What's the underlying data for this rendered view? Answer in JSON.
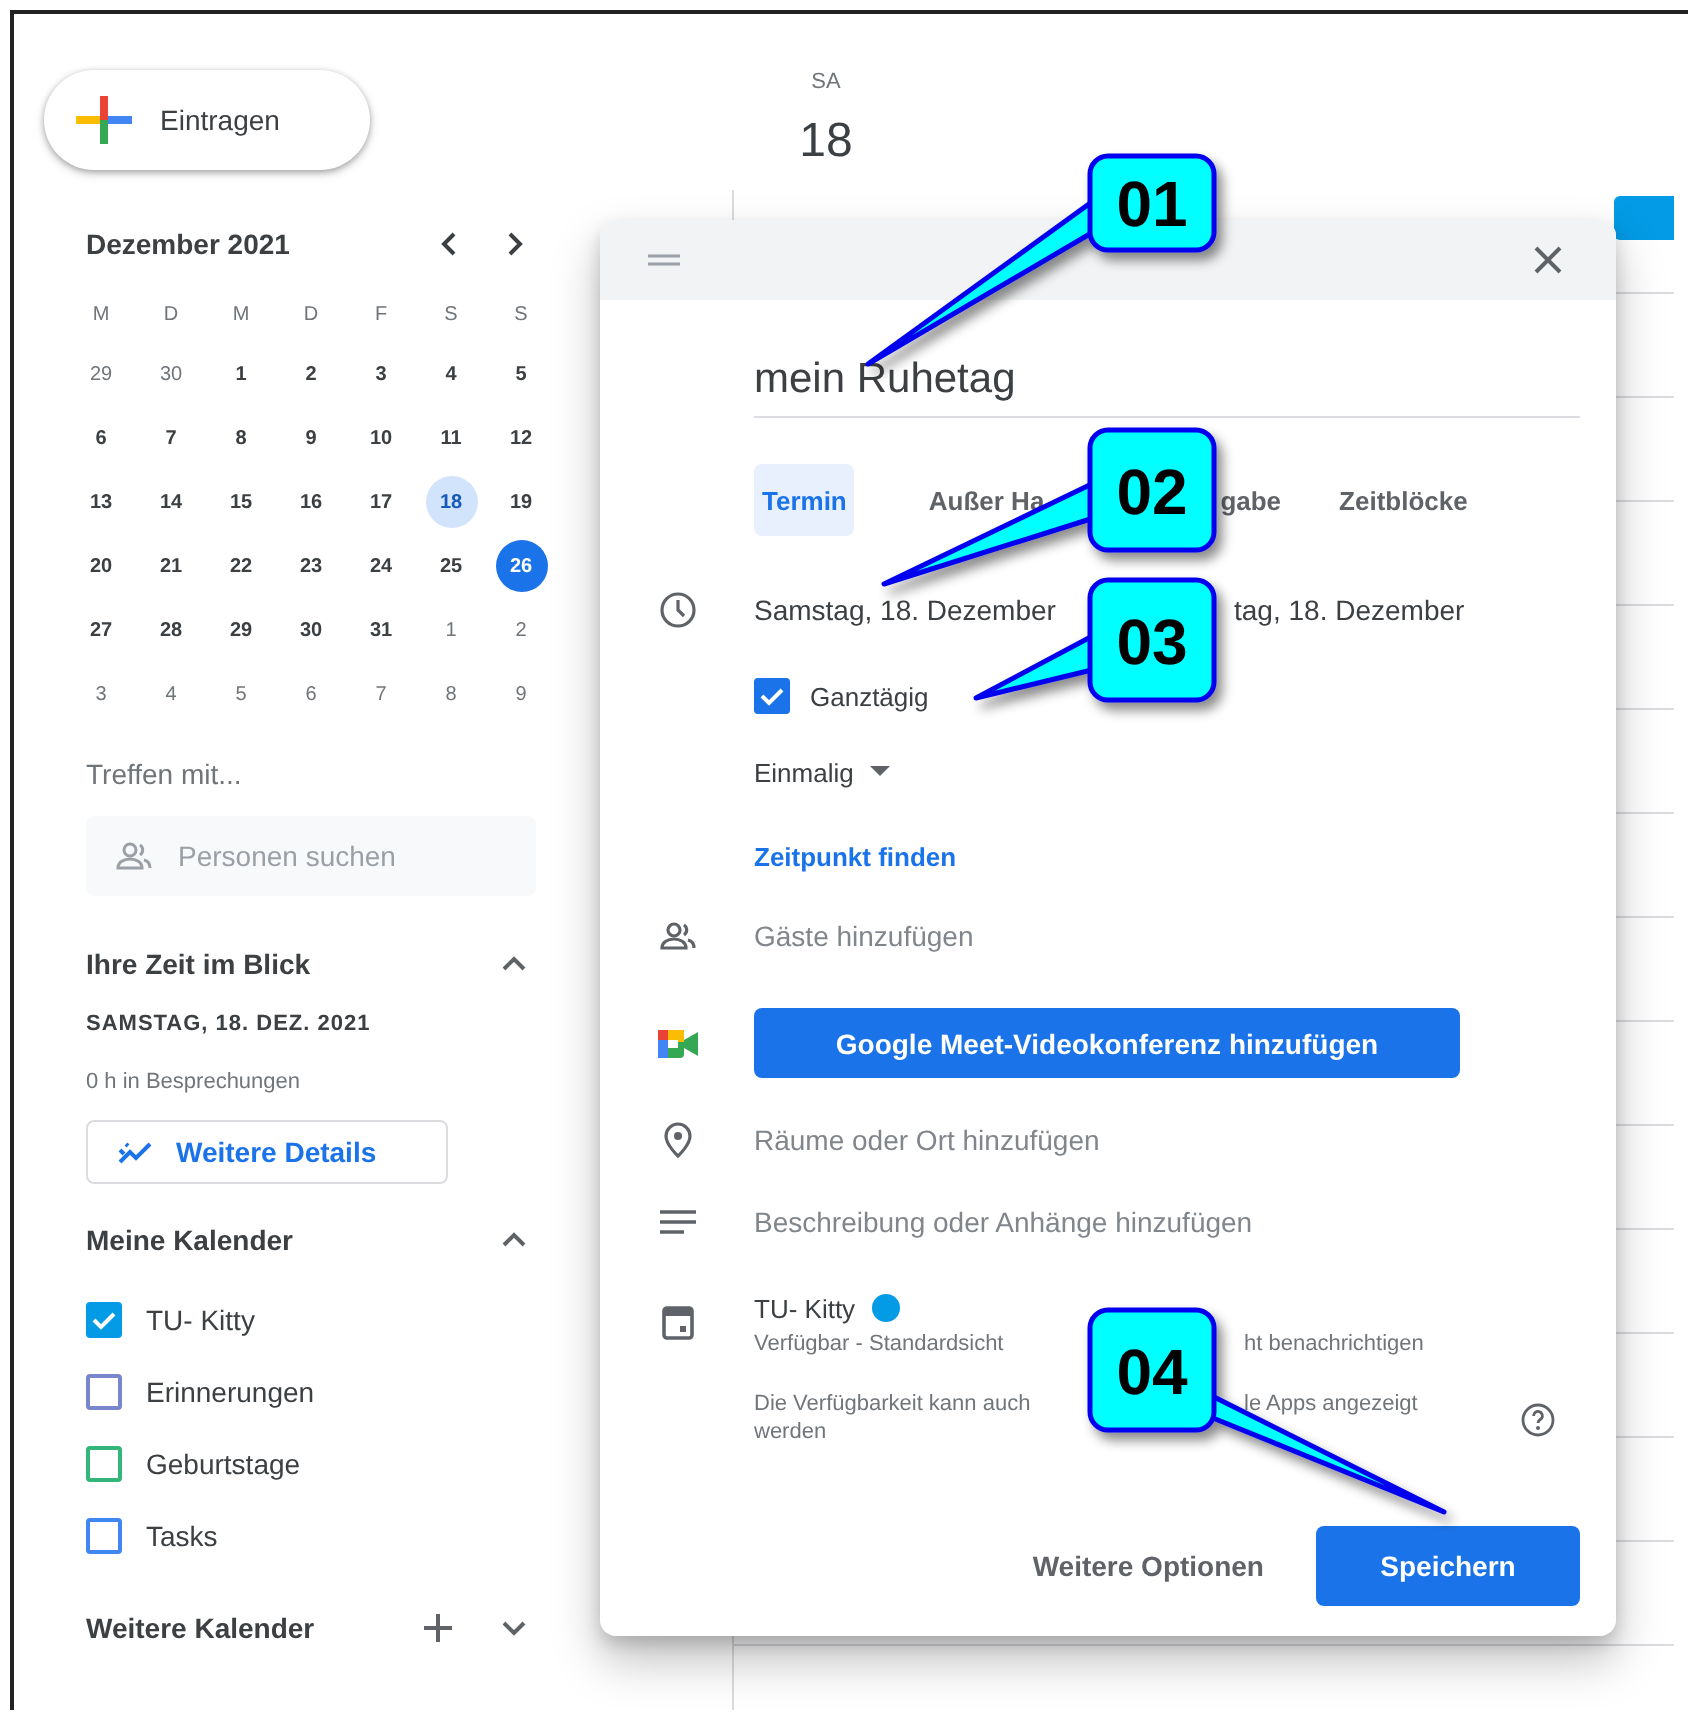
{
  "create_button": {
    "label": "Eintragen"
  },
  "mini_calendar": {
    "title": "Dezember 2021",
    "weekdays": [
      "M",
      "D",
      "M",
      "D",
      "F",
      "S",
      "S"
    ],
    "weeks": [
      [
        {
          "day": "29",
          "other_month": true,
          "selected": false,
          "today": false
        },
        {
          "day": "30",
          "other_month": true,
          "selected": false,
          "today": false
        },
        {
          "day": "1",
          "other_month": false,
          "selected": false,
          "today": false
        },
        {
          "day": "2",
          "other_month": false,
          "selected": false,
          "today": false
        },
        {
          "day": "3",
          "other_month": false,
          "selected": false,
          "today": false
        },
        {
          "day": "4",
          "other_month": false,
          "selected": false,
          "today": false
        },
        {
          "day": "5",
          "other_month": false,
          "selected": false,
          "today": false
        }
      ],
      [
        {
          "day": "6",
          "other_month": false,
          "selected": false,
          "today": false
        },
        {
          "day": "7",
          "other_month": false,
          "selected": false,
          "today": false
        },
        {
          "day": "8",
          "other_month": false,
          "selected": false,
          "today": false
        },
        {
          "day": "9",
          "other_month": false,
          "selected": false,
          "today": false
        },
        {
          "day": "10",
          "other_month": false,
          "selected": false,
          "today": false
        },
        {
          "day": "11",
          "other_month": false,
          "selected": false,
          "today": false
        },
        {
          "day": "12",
          "other_month": false,
          "selected": false,
          "today": false
        }
      ],
      [
        {
          "day": "13",
          "other_month": false,
          "selected": false,
          "today": false
        },
        {
          "day": "14",
          "other_month": false,
          "selected": false,
          "today": false
        },
        {
          "day": "15",
          "other_month": false,
          "selected": false,
          "today": false
        },
        {
          "day": "16",
          "other_month": false,
          "selected": false,
          "today": false
        },
        {
          "day": "17",
          "other_month": false,
          "selected": false,
          "today": false
        },
        {
          "day": "18",
          "other_month": false,
          "selected": true,
          "today": false
        },
        {
          "day": "19",
          "other_month": false,
          "selected": false,
          "today": false
        }
      ],
      [
        {
          "day": "20",
          "other_month": false,
          "selected": false,
          "today": false
        },
        {
          "day": "21",
          "other_month": false,
          "selected": false,
          "today": false
        },
        {
          "day": "22",
          "other_month": false,
          "selected": false,
          "today": false
        },
        {
          "day": "23",
          "other_month": false,
          "selected": false,
          "today": false
        },
        {
          "day": "24",
          "other_month": false,
          "selected": false,
          "today": false
        },
        {
          "day": "25",
          "other_month": false,
          "selected": false,
          "today": false
        },
        {
          "day": "26",
          "other_month": false,
          "selected": false,
          "today": true
        }
      ],
      [
        {
          "day": "27",
          "other_month": false,
          "selected": false,
          "today": false
        },
        {
          "day": "28",
          "other_month": false,
          "selected": false,
          "today": false
        },
        {
          "day": "29",
          "other_month": false,
          "selected": false,
          "today": false
        },
        {
          "day": "30",
          "other_month": false,
          "selected": false,
          "today": false
        },
        {
          "day": "31",
          "other_month": false,
          "selected": false,
          "today": false
        },
        {
          "day": "1",
          "other_month": true,
          "selected": false,
          "today": false
        },
        {
          "day": "2",
          "other_month": true,
          "selected": false,
          "today": false
        }
      ],
      [
        {
          "day": "3",
          "other_month": true,
          "selected": false,
          "today": false
        },
        {
          "day": "4",
          "other_month": true,
          "selected": false,
          "today": false
        },
        {
          "day": "5",
          "other_month": true,
          "selected": false,
          "today": false
        },
        {
          "day": "6",
          "other_month": true,
          "selected": false,
          "today": false
        },
        {
          "day": "7",
          "other_month": true,
          "selected": false,
          "today": false
        },
        {
          "day": "8",
          "other_month": true,
          "selected": false,
          "today": false
        },
        {
          "day": "9",
          "other_month": true,
          "selected": false,
          "today": false
        }
      ]
    ]
  },
  "meet_with": {
    "label": "Treffen mit...",
    "search_placeholder": "Personen suchen"
  },
  "time_insights": {
    "title": "Ihre Zeit im Blick",
    "date": "SAMSTAG, 18. DEZ. 2021",
    "summary": "0 h in Besprechungen",
    "details_button": "Weitere Details"
  },
  "my_calendars": {
    "title": "Meine Kalender",
    "items": [
      {
        "name": "TU- Kitty",
        "checked": true,
        "color": "#039be5"
      },
      {
        "name": "Erinnerungen",
        "checked": false,
        "color": "#7986cb"
      },
      {
        "name": "Geburtstage",
        "checked": false,
        "color": "#33b679"
      },
      {
        "name": "Tasks",
        "checked": false,
        "color": "#4285f4"
      }
    ]
  },
  "other_calendars": {
    "title": "Weitere Kalender"
  },
  "day_header": {
    "weekday": "SA",
    "day": "18"
  },
  "dialog": {
    "title_value": "mein Ruhetag",
    "tabs": [
      {
        "label": "Termin",
        "selected": true
      },
      {
        "label": "Außer Ha",
        "selected": false
      },
      {
        "label": "gabe",
        "selected": false
      },
      {
        "label": "Zeitblöcke",
        "selected": false
      }
    ],
    "date_start": "Samstag, 18. Dezember",
    "date_end": "tag, 18. Dezember",
    "all_day": {
      "label": "Ganztägig",
      "checked": true
    },
    "recurrence": "Einmalig",
    "find_time_link": "Zeitpunkt finden",
    "guests_placeholder": "Gäste hinzufügen",
    "meet_button": "Google Meet-Videokonferenz hinzufügen",
    "location_placeholder": "Räume oder Ort hinzufügen",
    "description_placeholder": "Beschreibung oder Anhänge hinzufügen",
    "calendar": {
      "name": "TU- Kitty",
      "color": "#039be5",
      "status_start": "Verfügbar - Standardsicht",
      "status_end": "ht benachrichtigen"
    },
    "note_start": "Die Verfügbarkeit kann auch",
    "note_end": "le Apps angezeigt",
    "note_line2": "werden",
    "more_options": "Weitere Optionen",
    "save": "Speichern"
  },
  "annotations": [
    {
      "label": "01"
    },
    {
      "label": "02"
    },
    {
      "label": "03"
    },
    {
      "label": "04"
    }
  ]
}
